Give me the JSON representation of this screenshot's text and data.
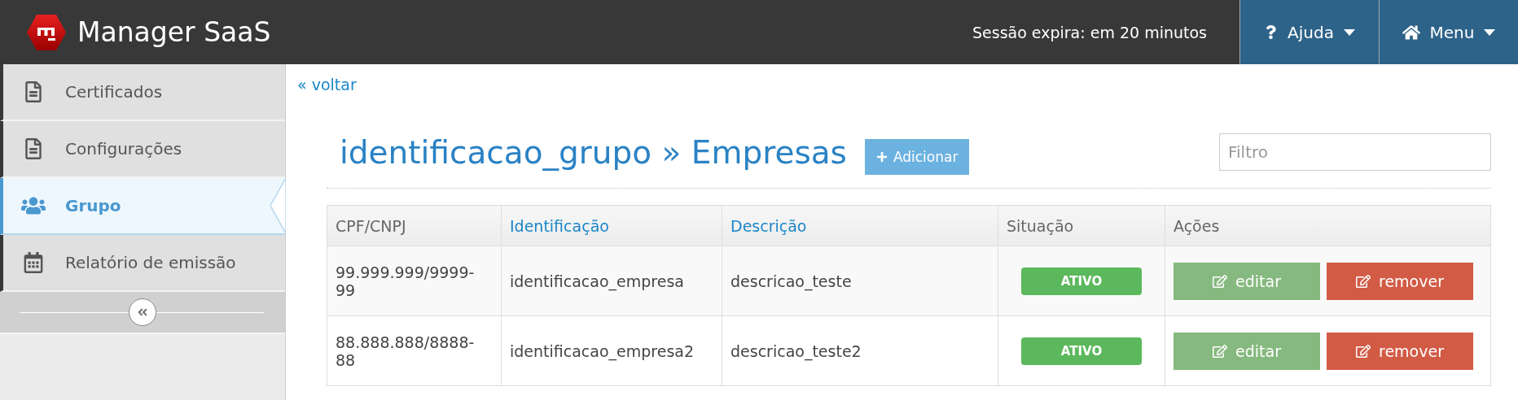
{
  "header": {
    "app_title": "Manager SaaS",
    "session": "Sessão expira: em 20 minutos",
    "menus": [
      {
        "label": "Ajuda",
        "kind": "help"
      },
      {
        "label": "Menu",
        "kind": "home"
      }
    ]
  },
  "sidebar": {
    "items": [
      {
        "label": "Certificados",
        "kind": "document",
        "selected": false
      },
      {
        "label": "Configurações",
        "kind": "document",
        "selected": false
      },
      {
        "label": "Grupo",
        "kind": "group",
        "selected": true
      },
      {
        "label": "Relatório de emissão",
        "kind": "calendar",
        "selected": false
      }
    ]
  },
  "back_link": "« voltar",
  "page_title": "identificacao_grupo » Empresas",
  "add_button": "Adicionar",
  "filter": {
    "placeholder": "Filtro"
  },
  "table": {
    "columns": [
      {
        "label": "CPF/CNPJ",
        "sortable": false
      },
      {
        "label": "Identificação",
        "sortable": true
      },
      {
        "label": "Descrição",
        "sortable": true
      },
      {
        "label": "Situação",
        "sortable": false
      },
      {
        "label": "Ações",
        "sortable": false
      }
    ],
    "rows": [
      {
        "cpf_cnpj": "99.999.999/9999-99",
        "identificacao": "identificacao_empresa",
        "descricao": "descricao_teste",
        "situacao": "ATIVO",
        "actions": [
          {
            "label": "editar",
            "kind": "edit"
          },
          {
            "label": "remover",
            "kind": "remove"
          }
        ]
      },
      {
        "cpf_cnpj": "88.888.888/8888-88",
        "identificacao": "identificacao_empresa2",
        "descricao": "descricao_teste2",
        "situacao": "ATIVO",
        "actions": [
          {
            "label": "editar",
            "kind": "edit"
          },
          {
            "label": "remover",
            "kind": "remove"
          }
        ]
      }
    ]
  }
}
